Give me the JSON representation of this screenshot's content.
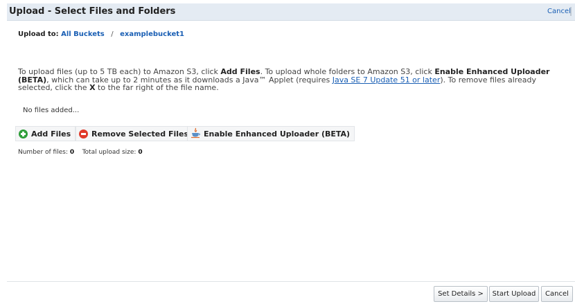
{
  "header": {
    "title": "Upload - Select Files and Folders",
    "cancel_label": "Cancel"
  },
  "breadcrumb": {
    "prefix": "Upload to:",
    "root": "All Buckets",
    "separator": "/",
    "bucket": "examplebucket1"
  },
  "instructions": {
    "t1": "To upload files (up to 5 TB each) to Amazon S3, click ",
    "b1": "Add Files",
    "t2": ". To upload whole folders to Amazon S3, click ",
    "b2": "Enable Enhanced Uploader (BETA)",
    "t3": ", which can take up to 2 minutes as it downloads a Java™ Applet (requires ",
    "link": "Java SE 7 Update 51 or later",
    "t4": "). To remove files already selected, click the ",
    "b3": "X",
    "t5": " to the far right of the file name."
  },
  "file_list": {
    "empty_text": "No files added..."
  },
  "actions": {
    "add_files": "Add Files",
    "remove_selected": "Remove Selected Files",
    "enable_enhanced": "Enable Enhanced Uploader (BETA)"
  },
  "stats": {
    "files_label": "Number of files:",
    "files_value": "0",
    "size_label": "Total upload size:",
    "size_value": "0"
  },
  "footer": {
    "set_details": "Set Details >",
    "start_upload": "Start Upload",
    "cancel": "Cancel"
  },
  "colors": {
    "header_bg": "#e4ebf3",
    "link": "#1a5fb4",
    "add_icon": "#2f9e3a",
    "remove_icon": "#e03a2a"
  },
  "icons": {
    "add": "plus-circle-icon",
    "remove": "minus-circle-icon",
    "java": "java-icon"
  }
}
